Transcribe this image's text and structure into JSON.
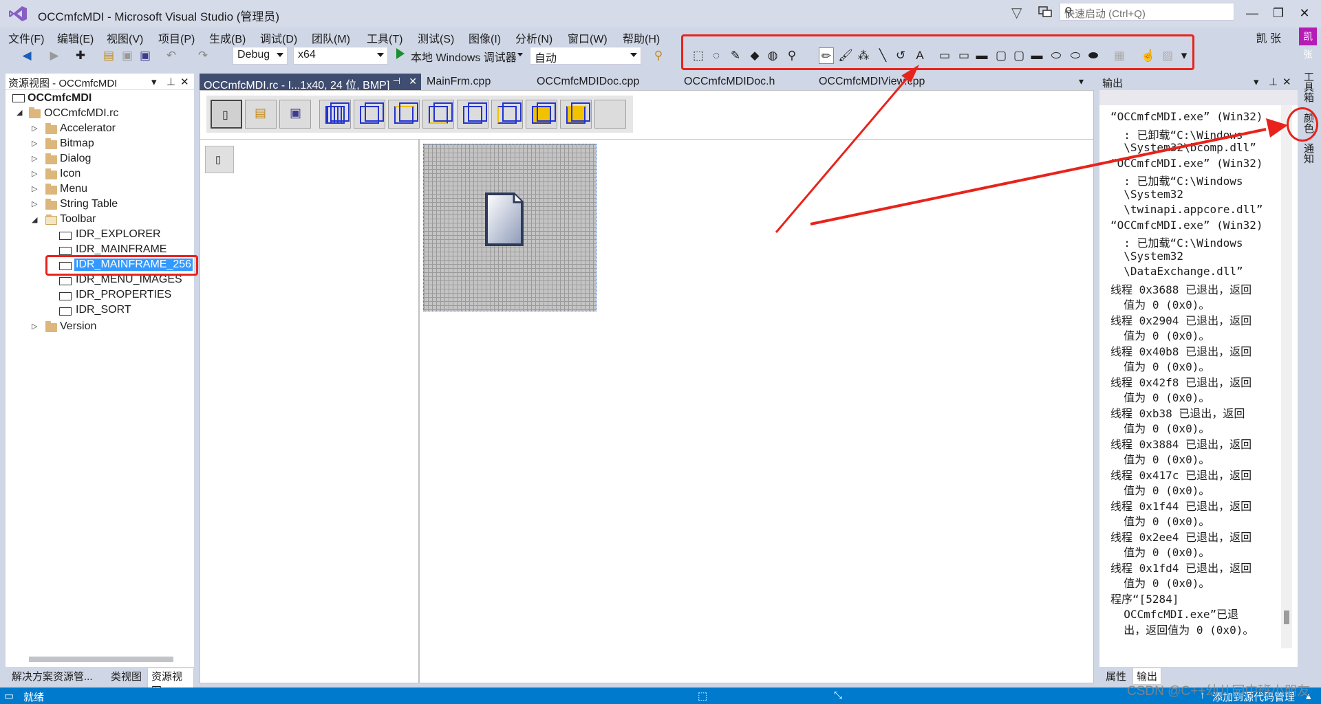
{
  "window": {
    "title": "OCCmfcMDI - Microsoft Visual Studio (管理员)",
    "quick_launch_placeholder": "快速启动 (Ctrl+Q)",
    "user": "凯 张",
    "avatar": "凯张"
  },
  "menu": [
    "文件(F)",
    "编辑(E)",
    "视图(V)",
    "项目(P)",
    "生成(B)",
    "调试(D)",
    "团队(M)",
    "工具(T)",
    "测试(S)",
    "图像(I)",
    "分析(N)",
    "窗口(W)",
    "帮助(H)"
  ],
  "toolbar": {
    "config": "Debug",
    "platform": "x64",
    "run_label": "本地 Windows 调试器",
    "run_mode": "自动"
  },
  "resource_view": {
    "title": "资源视图 - OCCmfcMDI",
    "root": "OCCmfcMDI",
    "rc_file": "OCCmfcMDI.rc",
    "folders": [
      "Accelerator",
      "Bitmap",
      "Dialog",
      "Icon",
      "Menu",
      "String Table",
      "Toolbar"
    ],
    "toolbar_items": [
      "IDR_EXPLORER",
      "IDR_MAINFRAME",
      "IDR_MAINFRAME_256",
      "IDR_MENU_IMAGES",
      "IDR_PROPERTIES",
      "IDR_SORT"
    ],
    "last_folder": "Version",
    "bottom_tabs": [
      "解决方案资源管...",
      "类视图",
      "资源视图"
    ]
  },
  "doc_tabs": [
    "OCCmfcMDI.rc - I...1x40, 24 位, BMP]",
    "MainFrm.cpp",
    "OCCmfcMDIDoc.cpp",
    "OCCmfcMDIDoc.h",
    "OCCmfcMDIView.cpp"
  ],
  "output": {
    "title": "输出",
    "lines": [
      "“OCCmfcMDI.exe” (Win32)",
      "  : 已卸载“C:\\Windows",
      "  \\System32\\bcomp.dll”",
      "“OCCmfcMDI.exe” (Win32)",
      "  : 已加载“C:\\Windows",
      "  \\System32",
      "  \\twinapi.appcore.dll”",
      "“OCCmfcMDI.exe” (Win32)",
      "  : 已加载“C:\\Windows",
      "  \\System32",
      "  \\DataExchange.dll”",
      "线程 0x3688 已退出，返回",
      "  值为 0 (0x0)。",
      "线程 0x2904 已退出，返回",
      "  值为 0 (0x0)。",
      "线程 0x40b8 已退出，返回",
      "  值为 0 (0x0)。",
      "线程 0x42f8 已退出，返回",
      "  值为 0 (0x0)。",
      "线程 0xb38 已退出，返回",
      "  值为 0 (0x0)。",
      "线程 0x3884 已退出，返回",
      "  值为 0 (0x0)。",
      "线程 0x417c 已退出，返回",
      "  值为 0 (0x0)。",
      "线程 0x1f44 已退出，返回",
      "  值为 0 (0x0)。",
      "线程 0x2ee4 已退出，返回",
      "  值为 0 (0x0)。",
      "线程 0x1fd4 已退出，返回",
      "  值为 0 (0x0)。",
      "程序“[5284]",
      "  OCCmfcMDI.exe”已退",
      "  出，返回值为 0 (0x0)。"
    ],
    "bottom_tabs": [
      "属性",
      "输出"
    ]
  },
  "side_tabs": [
    "工具箱",
    "颜色",
    "通知"
  ],
  "status": {
    "left": "就绪",
    "right": "添加到源代码管理"
  },
  "watermark": "CSDN @C++幼儿园中班小朋友",
  "colors": {
    "accent": "#007acc",
    "highlight": "#e8231b",
    "tab_active": "#3f4d70"
  }
}
